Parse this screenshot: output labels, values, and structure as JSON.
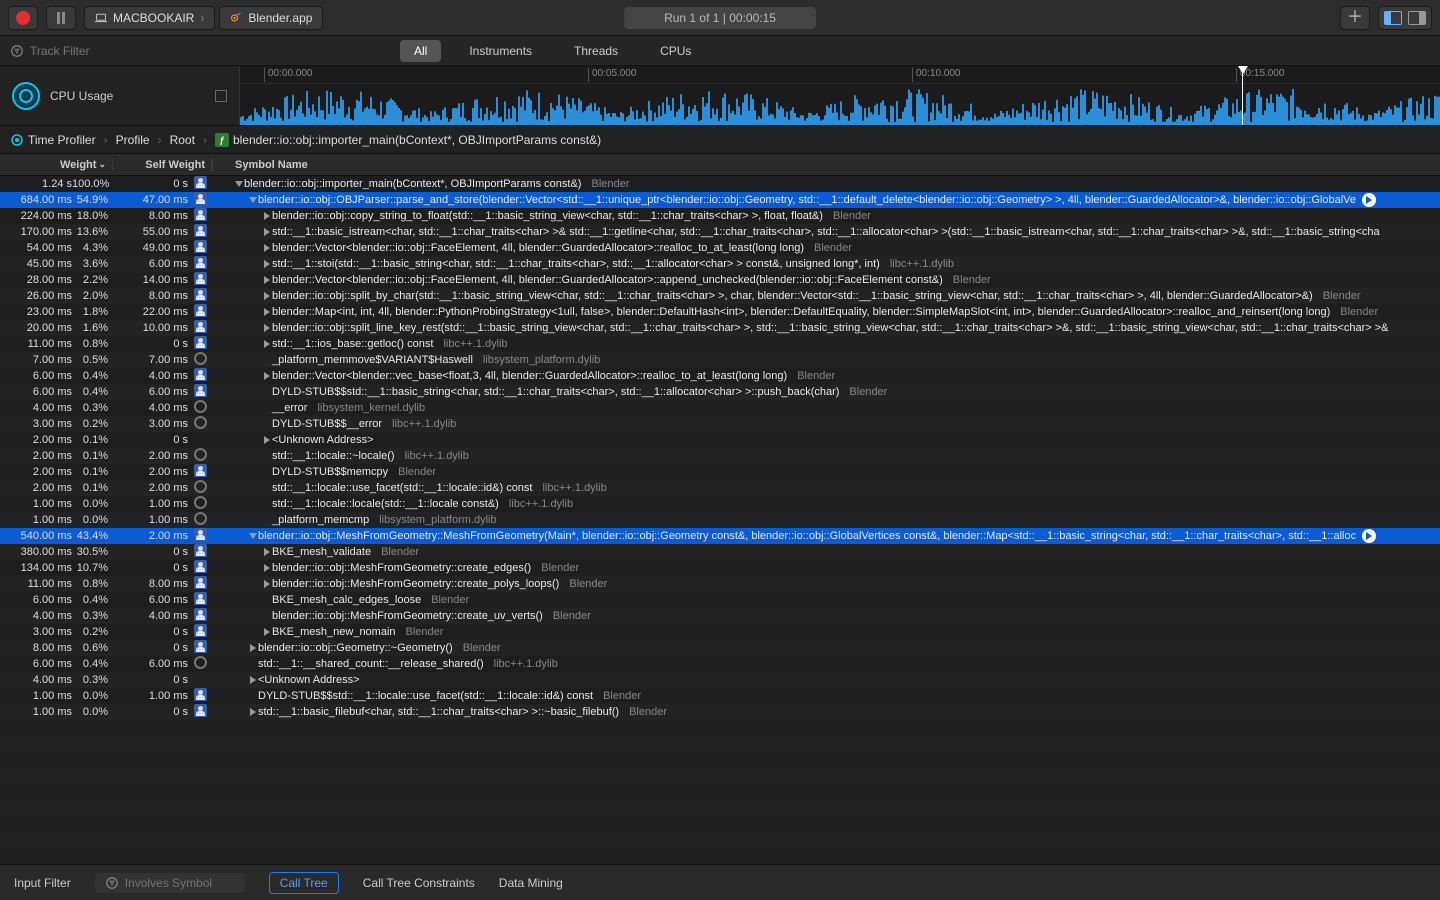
{
  "toolbar": {
    "device": "MACBOOKAIR",
    "app": "Blender.app",
    "run_status": "Run 1 of 1  |  00:00:15"
  },
  "filter": {
    "track_placeholder": "Track Filter",
    "tabs": {
      "all": "All",
      "instruments": "Instruments",
      "threads": "Threads",
      "cpus": "CPUs"
    }
  },
  "ruler": {
    "ticks": [
      {
        "pos": 0.02,
        "label": "00:00.000"
      },
      {
        "pos": 0.29,
        "label": "00:05.000"
      },
      {
        "pos": 0.56,
        "label": "00:10.000"
      },
      {
        "pos": 0.83,
        "label": "00:15.000"
      }
    ],
    "playhead_pos": 0.835
  },
  "track": {
    "name": "CPU Usage"
  },
  "breadcrumb": {
    "items": [
      {
        "icon": "target",
        "text": "Time Profiler"
      },
      {
        "icon": "",
        "text": "Profile"
      },
      {
        "icon": "",
        "text": "Root"
      },
      {
        "icon": "fn",
        "text": "blender::io::obj::importer_main(bContext*, OBJImportParams const&)"
      }
    ]
  },
  "columns": {
    "weight": "Weight",
    "self": "Self Weight",
    "symbol": "Symbol Name"
  },
  "rows": [
    {
      "w": "1.24 s",
      "p": "100.0%",
      "s": "0 s",
      "a": "p",
      "d": 0,
      "disc": "open",
      "sym": "blender::io::obj::importer_main(bContext*, OBJImportParams const&)",
      "lib": "Blender"
    },
    {
      "w": "684.00 ms",
      "p": "54.9%",
      "s": "47.00 ms",
      "a": "p",
      "d": 1,
      "disc": "open",
      "sym": "blender::io::obj::OBJParser::parse_and_store(blender::Vector<std::__1::unique_ptr<blender::io::obj::Geometry, std::__1::default_delete<blender::io::obj::Geometry> >, 4ll, blender::GuardedAllocator>&, blender::io::obj::GlobalVe",
      "lib": "",
      "sel": true,
      "badge": true
    },
    {
      "w": "224.00 ms",
      "p": "18.0%",
      "s": "8.00 ms",
      "a": "p",
      "d": 2,
      "disc": "closed",
      "sym": "blender::io::obj::copy_string_to_float(std::__1::basic_string_view<char, std::__1::char_traits<char> >, float, float&)",
      "lib": "Blender"
    },
    {
      "w": "170.00 ms",
      "p": "13.6%",
      "s": "55.00 ms",
      "a": "p",
      "d": 2,
      "disc": "closed",
      "sym": "std::__1::basic_istream<char, std::__1::char_traits<char> >& std::__1::getline<char, std::__1::char_traits<char>, std::__1::allocator<char> >(std::__1::basic_istream<char, std::__1::char_traits<char> >&, std::__1::basic_string<cha",
      "lib": ""
    },
    {
      "w": "54.00 ms",
      "p": "4.3%",
      "s": "49.00 ms",
      "a": "p",
      "d": 2,
      "disc": "closed",
      "sym": "blender::Vector<blender::io::obj::FaceElement, 4ll, blender::GuardedAllocator>::realloc_to_at_least(long long)",
      "lib": "Blender"
    },
    {
      "w": "45.00 ms",
      "p": "3.6%",
      "s": "6.00 ms",
      "a": "p",
      "d": 2,
      "disc": "closed",
      "sym": "std::__1::stoi(std::__1::basic_string<char, std::__1::char_traits<char>, std::__1::allocator<char> > const&, unsigned long*, int)",
      "lib": "libc++.1.dylib"
    },
    {
      "w": "28.00 ms",
      "p": "2.2%",
      "s": "14.00 ms",
      "a": "p",
      "d": 2,
      "disc": "closed",
      "sym": "blender::Vector<blender::io::obj::FaceElement, 4ll, blender::GuardedAllocator>::append_unchecked(blender::io::obj::FaceElement const&)",
      "lib": "Blender"
    },
    {
      "w": "26.00 ms",
      "p": "2.0%",
      "s": "8.00 ms",
      "a": "p",
      "d": 2,
      "disc": "closed",
      "sym": "blender::io::obj::split_by_char(std::__1::basic_string_view<char, std::__1::char_traits<char> >, char, blender::Vector<std::__1::basic_string_view<char, std::__1::char_traits<char> >, 4ll, blender::GuardedAllocator>&)",
      "lib": "Blender"
    },
    {
      "w": "23.00 ms",
      "p": "1.8%",
      "s": "22.00 ms",
      "a": "p",
      "d": 2,
      "disc": "closed",
      "sym": "blender::Map<int, int, 4ll, blender::PythonProbingStrategy<1ull, false>, blender::DefaultHash<int>, blender::DefaultEquality, blender::SimpleMapSlot<int, int>, blender::GuardedAllocator>::realloc_and_reinsert(long long)",
      "lib": "Blender"
    },
    {
      "w": "20.00 ms",
      "p": "1.6%",
      "s": "10.00 ms",
      "a": "p",
      "d": 2,
      "disc": "closed",
      "sym": "blender::io::obj::split_line_key_rest(std::__1::basic_string_view<char, std::__1::char_traits<char> >, std::__1::basic_string_view<char, std::__1::char_traits<char> >&, std::__1::basic_string_view<char, std::__1::char_traits<char> >&",
      "lib": ""
    },
    {
      "w": "11.00 ms",
      "p": "0.8%",
      "s": "0 s",
      "a": "p",
      "d": 2,
      "disc": "closed",
      "sym": "std::__1::ios_base::getloc() const",
      "lib": "libc++.1.dylib"
    },
    {
      "w": "7.00 ms",
      "p": "0.5%",
      "s": "7.00 ms",
      "a": "g",
      "d": 2,
      "disc": "",
      "sym": "_platform_memmove$VARIANT$Haswell",
      "lib": "libsystem_platform.dylib"
    },
    {
      "w": "6.00 ms",
      "p": "0.4%",
      "s": "4.00 ms",
      "a": "p",
      "d": 2,
      "disc": "closed",
      "sym": "blender::Vector<blender::vec_base<float,3, 4ll, blender::GuardedAllocator>::realloc_to_at_least(long long)",
      "lib": "Blender"
    },
    {
      "w": "6.00 ms",
      "p": "0.4%",
      "s": "6.00 ms",
      "a": "p",
      "d": 2,
      "disc": "",
      "sym": "DYLD-STUB$$std::__1::basic_string<char, std::__1::char_traits<char>, std::__1::allocator<char> >::push_back(char)",
      "lib": "Blender"
    },
    {
      "w": "4.00 ms",
      "p": "0.3%",
      "s": "4.00 ms",
      "a": "g",
      "d": 2,
      "disc": "",
      "sym": "__error",
      "lib": "libsystem_kernel.dylib"
    },
    {
      "w": "3.00 ms",
      "p": "0.2%",
      "s": "3.00 ms",
      "a": "g",
      "d": 2,
      "disc": "",
      "sym": "DYLD-STUB$$__error",
      "lib": "libc++.1.dylib"
    },
    {
      "w": "2.00 ms",
      "p": "0.1%",
      "s": "0 s",
      "a": "",
      "d": 2,
      "disc": "closed",
      "sym": "<Unknown Address>",
      "lib": ""
    },
    {
      "w": "2.00 ms",
      "p": "0.1%",
      "s": "2.00 ms",
      "a": "g",
      "d": 2,
      "disc": "",
      "sym": "std::__1::locale::~locale()",
      "lib": "libc++.1.dylib"
    },
    {
      "w": "2.00 ms",
      "p": "0.1%",
      "s": "2.00 ms",
      "a": "p",
      "d": 2,
      "disc": "",
      "sym": "DYLD-STUB$$memcpy",
      "lib": "Blender"
    },
    {
      "w": "2.00 ms",
      "p": "0.1%",
      "s": "2.00 ms",
      "a": "g",
      "d": 2,
      "disc": "",
      "sym": "std::__1::locale::use_facet(std::__1::locale::id&) const",
      "lib": "libc++.1.dylib"
    },
    {
      "w": "1.00 ms",
      "p": "0.0%",
      "s": "1.00 ms",
      "a": "g",
      "d": 2,
      "disc": "",
      "sym": "std::__1::locale::locale(std::__1::locale const&)",
      "lib": "libc++.1.dylib"
    },
    {
      "w": "1.00 ms",
      "p": "0.0%",
      "s": "1.00 ms",
      "a": "g",
      "d": 2,
      "disc": "",
      "sym": "_platform_memcmp",
      "lib": "libsystem_platform.dylib"
    },
    {
      "w": "540.00 ms",
      "p": "43.4%",
      "s": "2.00 ms",
      "a": "p",
      "d": 1,
      "disc": "open",
      "sym": "blender::io::obj::MeshFromGeometry::MeshFromGeometry(Main*, blender::io::obj::Geometry const&, blender::io::obj::GlobalVertices const&, blender::Map<std::__1::basic_string<char, std::__1::char_traits<char>, std::__1::alloc",
      "lib": "",
      "sel": true,
      "badge": true
    },
    {
      "w": "380.00 ms",
      "p": "30.5%",
      "s": "0 s",
      "a": "p",
      "d": 2,
      "disc": "closed",
      "sym": "BKE_mesh_validate",
      "lib": "Blender"
    },
    {
      "w": "134.00 ms",
      "p": "10.7%",
      "s": "0 s",
      "a": "p",
      "d": 2,
      "disc": "closed",
      "sym": "blender::io::obj::MeshFromGeometry::create_edges()",
      "lib": "Blender"
    },
    {
      "w": "11.00 ms",
      "p": "0.8%",
      "s": "8.00 ms",
      "a": "p",
      "d": 2,
      "disc": "closed",
      "sym": "blender::io::obj::MeshFromGeometry::create_polys_loops()",
      "lib": "Blender"
    },
    {
      "w": "6.00 ms",
      "p": "0.4%",
      "s": "6.00 ms",
      "a": "p",
      "d": 2,
      "disc": "",
      "sym": "BKE_mesh_calc_edges_loose",
      "lib": "Blender"
    },
    {
      "w": "4.00 ms",
      "p": "0.3%",
      "s": "4.00 ms",
      "a": "p",
      "d": 2,
      "disc": "",
      "sym": "blender::io::obj::MeshFromGeometry::create_uv_verts()",
      "lib": "Blender"
    },
    {
      "w": "3.00 ms",
      "p": "0.2%",
      "s": "0 s",
      "a": "p",
      "d": 2,
      "disc": "closed",
      "sym": "BKE_mesh_new_nomain",
      "lib": "Blender"
    },
    {
      "w": "8.00 ms",
      "p": "0.6%",
      "s": "0 s",
      "a": "p",
      "d": 1,
      "disc": "closed",
      "sym": "blender::io::obj::Geometry::~Geometry()",
      "lib": "Blender"
    },
    {
      "w": "6.00 ms",
      "p": "0.4%",
      "s": "6.00 ms",
      "a": "g",
      "d": 1,
      "disc": "",
      "sym": "std::__1::__shared_count::__release_shared()",
      "lib": "libc++.1.dylib"
    },
    {
      "w": "4.00 ms",
      "p": "0.3%",
      "s": "0 s",
      "a": "",
      "d": 1,
      "disc": "closed",
      "sym": "<Unknown Address>",
      "lib": ""
    },
    {
      "w": "1.00 ms",
      "p": "0.0%",
      "s": "1.00 ms",
      "a": "p",
      "d": 1,
      "disc": "",
      "sym": "DYLD-STUB$$std::__1::locale::use_facet(std::__1::locale::id&) const",
      "lib": "Blender"
    },
    {
      "w": "1.00 ms",
      "p": "0.0%",
      "s": "0 s",
      "a": "p",
      "d": 1,
      "disc": "closed",
      "sym": "std::__1::basic_filebuf<char, std::__1::char_traits<char> >::~basic_filebuf()",
      "lib": "Blender"
    }
  ],
  "bottom": {
    "input_filter": "Input Filter",
    "involves_placeholder": "Involves Symbol",
    "call_tree": "Call Tree",
    "constraints": "Call Tree Constraints",
    "mining": "Data Mining"
  }
}
